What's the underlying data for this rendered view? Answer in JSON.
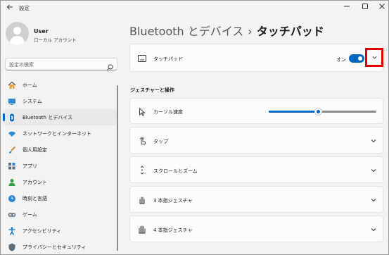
{
  "window": {
    "title": "設定",
    "back_icon": "back-arrow-icon"
  },
  "profile": {
    "name": "User",
    "account_type": "ローカル アカウント"
  },
  "search": {
    "placeholder": "設定の検索"
  },
  "sidebar": {
    "items": [
      {
        "label": "ホーム",
        "icon": "home-icon",
        "active": false
      },
      {
        "label": "システム",
        "icon": "system-icon",
        "active": false
      },
      {
        "label": "Bluetooth とデバイス",
        "icon": "bluetooth-icon",
        "active": true
      },
      {
        "label": "ネットワークとインターネット",
        "icon": "network-icon",
        "active": false
      },
      {
        "label": "個人用設定",
        "icon": "brush-icon",
        "active": false
      },
      {
        "label": "アプリ",
        "icon": "apps-icon",
        "active": false
      },
      {
        "label": "アカウント",
        "icon": "account-icon",
        "active": false
      },
      {
        "label": "時刻と言語",
        "icon": "time-language-icon",
        "active": false
      },
      {
        "label": "ゲーム",
        "icon": "gaming-icon",
        "active": false
      },
      {
        "label": "アクセシビリティ",
        "icon": "accessibility-icon",
        "active": false
      },
      {
        "label": "プライバシーとセキュリティ",
        "icon": "shield-icon",
        "active": false
      }
    ]
  },
  "breadcrumb": {
    "parent": "Bluetooth とデバイス",
    "separator": "›",
    "current": "タッチパッド"
  },
  "touchpad": {
    "label": "タッチパッド",
    "toggle_state": "オン",
    "toggle_on": true
  },
  "section": {
    "gestures_title": "ジェスチャーと操作"
  },
  "cursor_speed": {
    "label": "カーソル速度",
    "value_fraction": 0.46
  },
  "cards": [
    {
      "label": "タップ",
      "icon": "tap-icon"
    },
    {
      "label": "スクロールとズーム",
      "icon": "scroll-icon"
    },
    {
      "label": "3 本指ジェスチャ",
      "icon": "three-finger-icon"
    },
    {
      "label": "4 本指ジェスチャ",
      "icon": "four-finger-icon"
    }
  ],
  "colors": {
    "accent": "#0067c0",
    "highlight_box": "#e00000"
  }
}
